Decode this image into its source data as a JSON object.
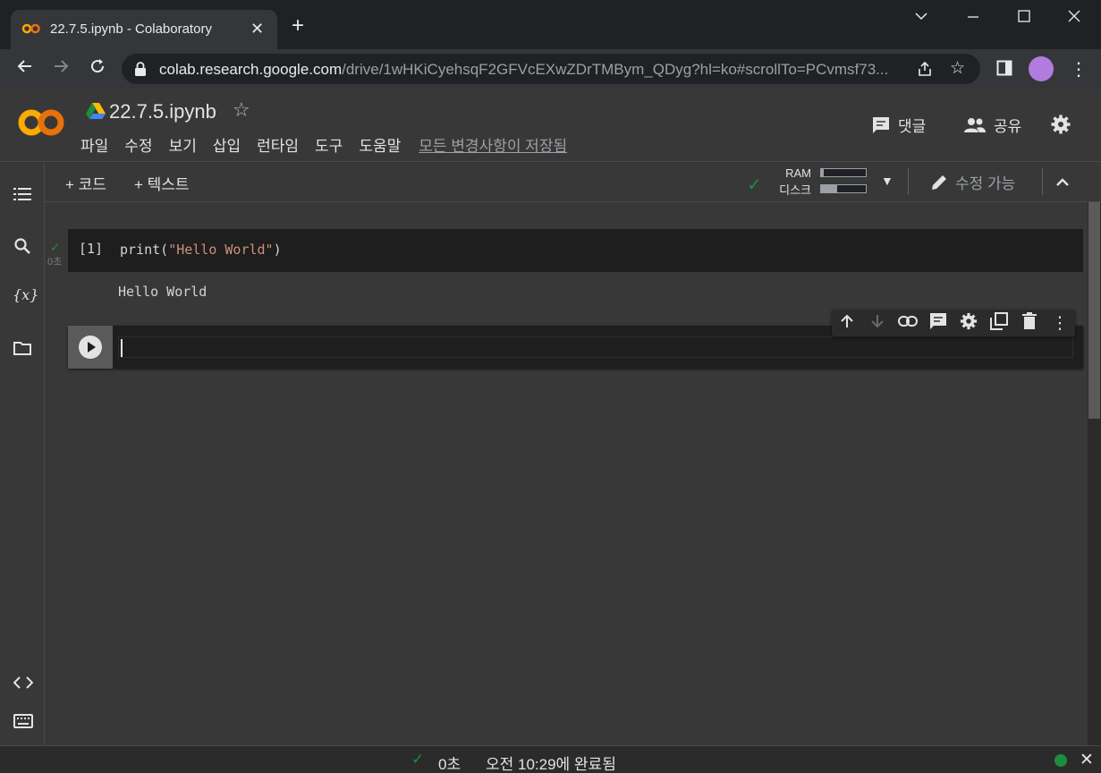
{
  "browser": {
    "tab_title": "22.7.5.ipynb - Colaboratory",
    "tab_close": "✕",
    "new_tab": "+",
    "url_host": "colab.research.google.com",
    "url_path": "/drive/1wHKiCyehsqF2GFVcEXwZDrTMBym_QDyg?hl=ko#scrollTo=PCvmsf73..."
  },
  "colab": {
    "notebook_title": "22.7.5.ipynb",
    "menu": [
      "파일",
      "수정",
      "보기",
      "삽입",
      "런타임",
      "도구",
      "도움말"
    ],
    "save_status": "모든 변경사항이 저장됨",
    "comment_label": "댓글",
    "share_label": "공유"
  },
  "toolbar": {
    "add_code": "+ 코드",
    "add_text": "+ 텍스트",
    "ram_label": "RAM",
    "disk_label": "디스크",
    "ram_usage": 0.05,
    "disk_usage": 0.35,
    "edit_mode": "수정 가능"
  },
  "cells": {
    "cell1": {
      "exec_count": "[1]",
      "exec_time": "0초",
      "code_fn": "print(",
      "code_str": "\"Hello World\"",
      "code_end": ")",
      "output": "Hello World"
    }
  },
  "statusbar": {
    "duration": "0초",
    "completed": "오전 10:29에 완료됨"
  },
  "colors": {
    "accent_green": "#1e8e3e",
    "colab_orange": "#f9ab00",
    "string_color": "#ce9178"
  }
}
